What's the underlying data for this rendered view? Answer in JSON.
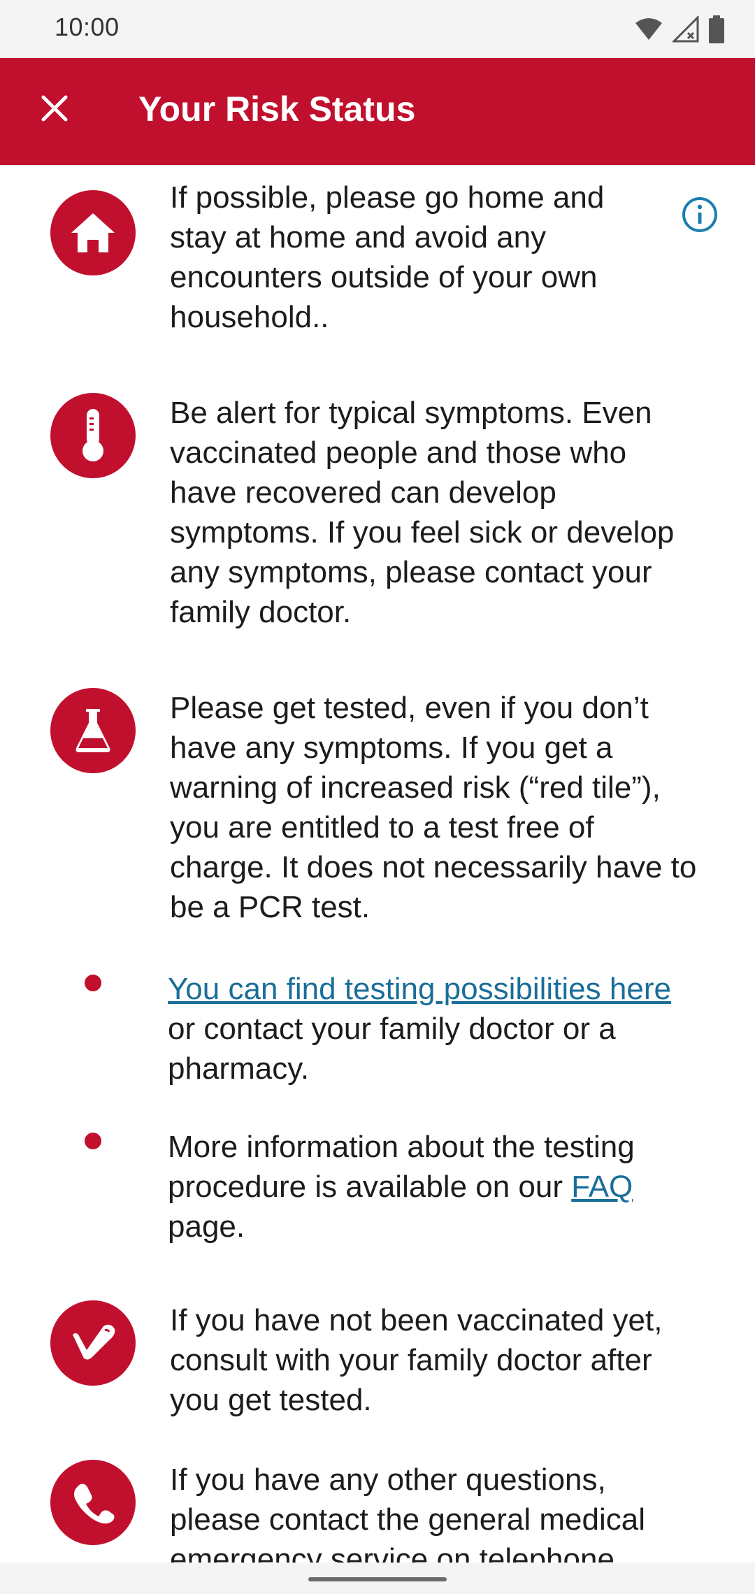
{
  "status_bar": {
    "time": "10:00"
  },
  "app_bar": {
    "title": "Your Risk Status"
  },
  "items": [
    {
      "icon": "home-icon",
      "text": "If possible, please go home and stay at home and avoid any encounters outside of your own household.."
    },
    {
      "icon": "thermometer-icon",
      "text": "Be alert for typical symptoms. Even vaccinated people and those who have recovered can develop symptoms. If you feel sick or develop any symptoms, please contact your family doctor."
    },
    {
      "icon": "test-flask-icon",
      "text": "Please get tested, even if you don’t have any symptoms. If you get a warning of increased risk (“red tile”), you are entitled to a test free of charge. It does not necessarily have to be a PCR test."
    },
    {
      "icon": "vaccination-arm-icon",
      "text": "If you have not been vaccinated yet, consult with your family doctor after you get tested."
    },
    {
      "icon": "phone-icon",
      "text": "If you have any other questions, please contact the general medical emergency service on telephone"
    }
  ],
  "bullets": [
    {
      "link_text": "You can find testing possibilities here",
      "rest_text": " or contact your family doctor or a pharmacy."
    },
    {
      "pre_text": "More information about the testing procedure is available on our ",
      "link_text": "FAQ",
      "post_text": " page."
    }
  ],
  "colors": {
    "brand": "#c1102e",
    "link": "#1a6e99",
    "info_icon": "#1a7fb0"
  }
}
